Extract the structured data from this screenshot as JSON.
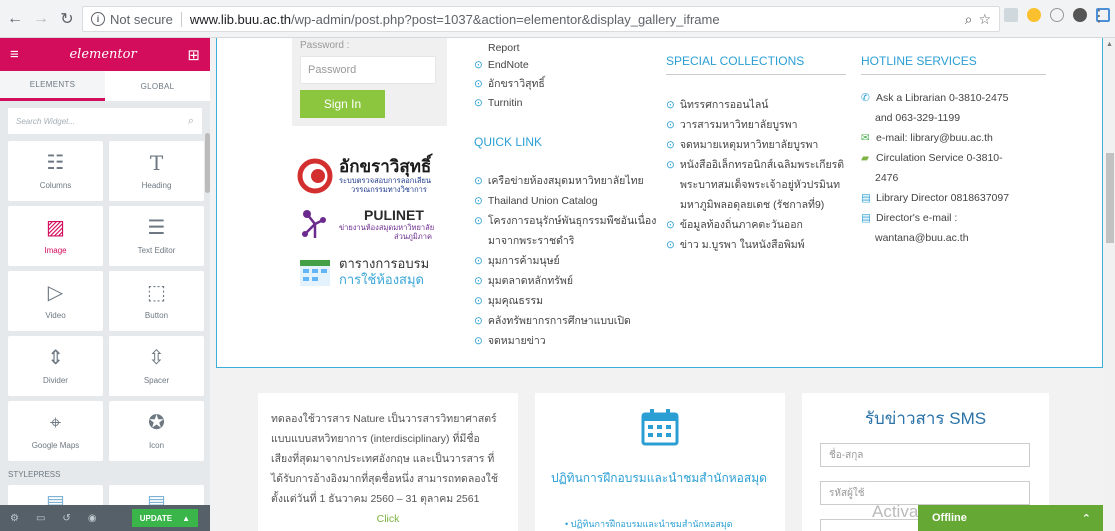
{
  "browser": {
    "not_secure": "Not secure",
    "url_domain": "www.lib.buu.ac.th",
    "url_path": "/wp-admin/post.php?post=1037&action=elementor&display_gallery_iframe"
  },
  "panel": {
    "logo": "elementor",
    "tabs": [
      "ELEMENTS",
      "GLOBAL"
    ],
    "search_placeholder": "Search Widget...",
    "widgets": [
      {
        "label": "Columns",
        "icon": "columns-icon"
      },
      {
        "label": "Heading",
        "icon": "heading-icon"
      },
      {
        "label": "Image",
        "icon": "image-icon"
      },
      {
        "label": "Text Editor",
        "icon": "text-editor-icon"
      },
      {
        "label": "Video",
        "icon": "video-icon"
      },
      {
        "label": "Button",
        "icon": "button-icon"
      },
      {
        "label": "Divider",
        "icon": "divider-icon"
      },
      {
        "label": "Spacer",
        "icon": "spacer-icon"
      },
      {
        "label": "Google Maps",
        "icon": "map-icon"
      },
      {
        "label": "Icon",
        "icon": "star-icon"
      }
    ],
    "stylepress": "STYLEPRESS",
    "update_label": "UPDATE",
    "accent": "#d30c5c"
  },
  "login": {
    "password_label": "Password :",
    "password_placeholder": "Password",
    "signin_label": "Sign In"
  },
  "logos": {
    "aksara_main": "อักขราวิสุทธิ์",
    "aksara_sub1": "ระบบตรวจสอบการลอกเลียน",
    "aksara_sub2": "วรรณกรรมทางวิชาการ",
    "pulinet_main": "PULINET",
    "pulinet_sub1": "ข่ายงานห้องสมุดมหาวิทยาลัย",
    "pulinet_sub2": "ส่วนภูมิภาค",
    "schedule_main": "ตารางการอบรม",
    "schedule_sub": "การใช้ห้องสมุด"
  },
  "services": {
    "top_items": [
      "Report",
      "EndNote",
      "อักขราวิสุทธิ์",
      "Turnitin"
    ]
  },
  "quick_link": {
    "heading": "QUICK LINK",
    "items": [
      "เครือข่ายห้องสมุดมหาวิทยาลัยไทย",
      "Thailand Union Catalog",
      "โครงการอนุรักษ์พันธุกรรมพืชอันเนื่อง",
      "มาจากพระราชดำริ",
      "มุมการค้ามนุษย์",
      "มุมตลาดหลักทรัพย์",
      "มุมคุณธรรม",
      "คลังทรัพยากรการศึกษาแบบเปิด",
      "จดหมายข่าว"
    ]
  },
  "special": {
    "heading": "SPECIAL COLLECTIONS",
    "items": [
      "นิทรรศการออนไลน์",
      "วารสารมหาวิทยาลัยบูรพา",
      "จดหมายเหตุมหาวิทยาลัยบูรพา",
      "หนังสืออิเล็กทรอนิกส์เฉลิมพระเกียรติ",
      "พระบาทสมเด็จพระเจ้าอยู่หัวปรมินท",
      "มหาภูมิพลอดุลยเดช (รัชกาลที่9)",
      "ข้อมูลท้องถิ่นภาคตะวันออก",
      "ข่าว ม.บูรพา ในหนังสือพิมพ์"
    ]
  },
  "hotline": {
    "heading": "HOTLINE SERVICES",
    "items": [
      "Ask a Librarian 0-3810-2475",
      "and 063-329-1199",
      "e-mail: library@buu.ac.th",
      "Circulation Service 0-3810-",
      "2476",
      "Library Director 0818637097",
      "Director's e-mail :",
      "wantana@buu.ac.th"
    ]
  },
  "card1": {
    "lines": [
      "ทดลองใช้วารสาร Nature เป็นวารสารวิทยาศาสตร์",
      "แบบแบบสหวิทยาการ (interdisciplinary) ที่มีชื่อ",
      "เสียงที่สุดมาจากประเทศอังกฤษ และเป็นวารสาร ที่",
      "ได้รับการอ้างอิงมากที่สุดชื่อหนึ่ง สามารถทดลองใช้",
      "ตั้งแต่วันที่ 1 ธันวาคม 2560 – 31 ตุลาคม 2561"
    ],
    "click": "Click"
  },
  "card2": {
    "title": "ปฏิทินการฝึกอบรมและนำชมสำนักหอสมุด",
    "item": "ปฏิทินการฝึกอบรมและนำชมสำนักหอสมุด"
  },
  "card3": {
    "title": "รับข่าวสาร SMS",
    "name_placeholder": "ชื่อ-สกุล",
    "id_placeholder": "รหัสผู้ใช้"
  },
  "chat": {
    "label": "Offline"
  },
  "watermark": "Activate Windows"
}
